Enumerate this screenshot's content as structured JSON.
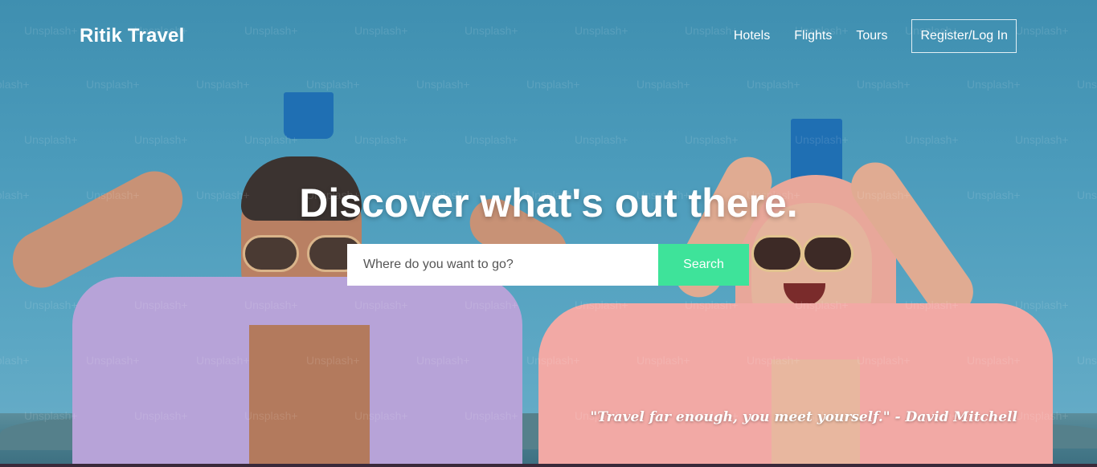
{
  "nav": {
    "brand": "Ritik Travel",
    "links": [
      "Hotels",
      "Flights",
      "Tours"
    ],
    "auth_button": "Register/Log In"
  },
  "hero": {
    "headline": "Discover what's out there.",
    "search": {
      "placeholder": "Where do you want to go?",
      "button_label": "Search"
    },
    "quote": "\"Travel far enough, you meet yourself.\" - David Mitchell",
    "watermark": "Unsplash+"
  },
  "colors": {
    "search_button": "#3ee39a",
    "text": "#ffffff",
    "sky": "#4b9bbb"
  }
}
